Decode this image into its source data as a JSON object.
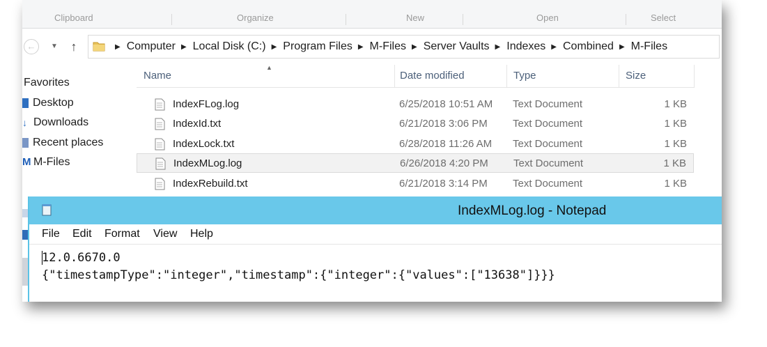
{
  "ribbon": {
    "groups": [
      "Clipboard",
      "Organize",
      "New",
      "Open",
      "Select"
    ]
  },
  "address_bar": {
    "back_icon": "back-arrow-icon",
    "up_icon": "up-arrow-icon",
    "crumbs": [
      "Computer",
      "Local Disk (C:)",
      "Program Files",
      "M-Files",
      "Server Vaults",
      "Indexes",
      "Combined",
      "M-Files"
    ]
  },
  "sidebar": {
    "header": "Favorites",
    "items": [
      {
        "label": "Desktop",
        "icon": "desktop-icon"
      },
      {
        "label": "Downloads",
        "icon": "downloads-icon"
      },
      {
        "label": "Recent places",
        "icon": "recent-places-icon"
      },
      {
        "label": "M-Files",
        "icon": "m-files-icon"
      }
    ]
  },
  "columns": {
    "name": "Name",
    "date": "Date modified",
    "type": "Type",
    "size": "Size"
  },
  "files": [
    {
      "name": "IndexFLog.log",
      "date": "6/25/2018 10:51 AM",
      "type": "Text Document",
      "size": "1 KB"
    },
    {
      "name": "IndexId.txt",
      "date": "6/21/2018 3:06 PM",
      "type": "Text Document",
      "size": "1 KB"
    },
    {
      "name": "IndexLock.txt",
      "date": "6/28/2018 11:26 AM",
      "type": "Text Document",
      "size": "1 KB"
    },
    {
      "name": "IndexMLog.log",
      "date": "6/26/2018 4:20 PM",
      "type": "Text Document",
      "size": "1 KB"
    },
    {
      "name": "IndexRebuild.txt",
      "date": "6/21/2018 3:14 PM",
      "type": "Text Document",
      "size": "1 KB"
    }
  ],
  "selected_file_index": 3,
  "notepad": {
    "title": "IndexMLog.log - Notepad",
    "menu": [
      "File",
      "Edit",
      "Format",
      "View",
      "Help"
    ],
    "content_lines": [
      "12.0.6670.0",
      "{\"timestampType\":\"integer\",\"timestamp\":{\"integer\":{\"values\":[\"13638\"]}}}"
    ]
  },
  "colors": {
    "notepad_title_bar": "#69c8ea",
    "selection": "#f2f2f2",
    "column_header_text": "#4c607a"
  }
}
